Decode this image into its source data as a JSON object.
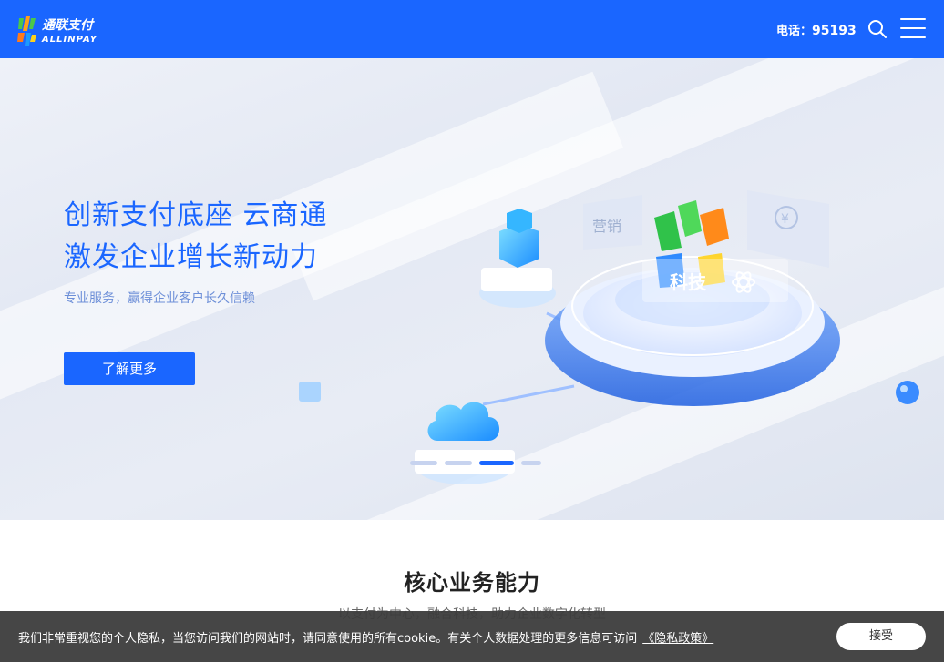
{
  "header": {
    "brand_cn": "通联支付",
    "brand_en": "ALLINPAY",
    "phone_label": "电话：",
    "phone_number": "95193"
  },
  "hero": {
    "title_line1": "创新支付底座 云商通",
    "title_line2": "激发企业增长新动力",
    "subtitle": "专业服务，赢得企业客户长久信赖",
    "button": "了解更多",
    "art_label": "科技",
    "art_panel_left": "营销",
    "art_panel_right_symbol": "¥",
    "carousel": {
      "count": 4,
      "active_index": 2
    }
  },
  "section": {
    "title": "核心业务能力",
    "subtitle": "以支付为中心，融合科技，助力企业数字化转型"
  },
  "cookie": {
    "text": "我们非常重视您的个人隐私，当您访问我们的网站时，请同意使用的所有cookie。有关个人数据处理的更多信息可访问",
    "link": "《隐私政策》",
    "accept": "接受"
  },
  "colors": {
    "primary": "#1a66ff",
    "cookie_bg": "#3c3c3c"
  }
}
